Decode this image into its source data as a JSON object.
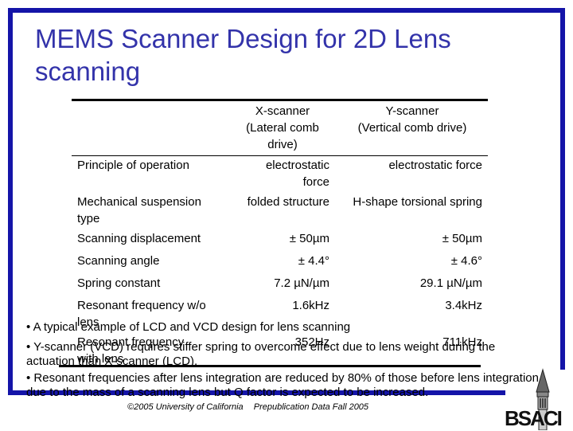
{
  "slide": {
    "title": "MEMS Scanner Design for 2D Lens scanning",
    "accent_color": "#1414A8",
    "title_color": "#3333AA"
  },
  "table": {
    "headers": {
      "x_scanner": [
        "X-scanner",
        "(Lateral comb",
        "drive)"
      ],
      "y_scanner": [
        "Y-scanner",
        "(Vertical comb drive)"
      ]
    },
    "rows": [
      {
        "label": [
          "Principle of operation"
        ],
        "x": [
          "electrostatic",
          "force"
        ],
        "y": [
          "electrostatic force"
        ]
      },
      {
        "label": [
          "Mechanical suspension",
          "type"
        ],
        "x": [
          "folded structure"
        ],
        "y": [
          "H-shape torsional spring"
        ]
      },
      {
        "label": [
          "Scanning displacement"
        ],
        "x": [
          "± 50µm"
        ],
        "y": [
          "± 50µm"
        ]
      },
      {
        "label": [
          "Scanning angle"
        ],
        "x": [
          "± 4.4°"
        ],
        "y": [
          "± 4.6°"
        ]
      },
      {
        "label": [
          "Spring constant"
        ],
        "x": [
          "7.2 µN/µm"
        ],
        "y": [
          "29.1 µN/µm"
        ]
      },
      {
        "label": [
          "Resonant frequency w/o",
          "lens"
        ],
        "x": [
          "1.6kHz"
        ],
        "y": [
          "3.4kHz"
        ]
      },
      {
        "label": [
          "Resonant frequency",
          "with lens"
        ],
        "x": [
          "352Hz"
        ],
        "y": [
          "711kHz"
        ]
      }
    ]
  },
  "bullets": [
    "• A typical example of LCD and VCD design for lens scanning",
    "• Y-scanner (VCD) requires stiffer spring to overcome effect due to lens weight during the actuation than X-scanner (LCD).",
    "• Resonant frequencies after lens integration are reduced by 80% of those before lens integration due to the mass of  a scanning lens but Q factor is expected to be increased."
  ],
  "footer": {
    "copyright": "©2005 University of California",
    "note": "Prepublication Data Fall 2005"
  },
  "logo": {
    "text": "BSACI",
    "icon": "campanile-tower-icon"
  }
}
